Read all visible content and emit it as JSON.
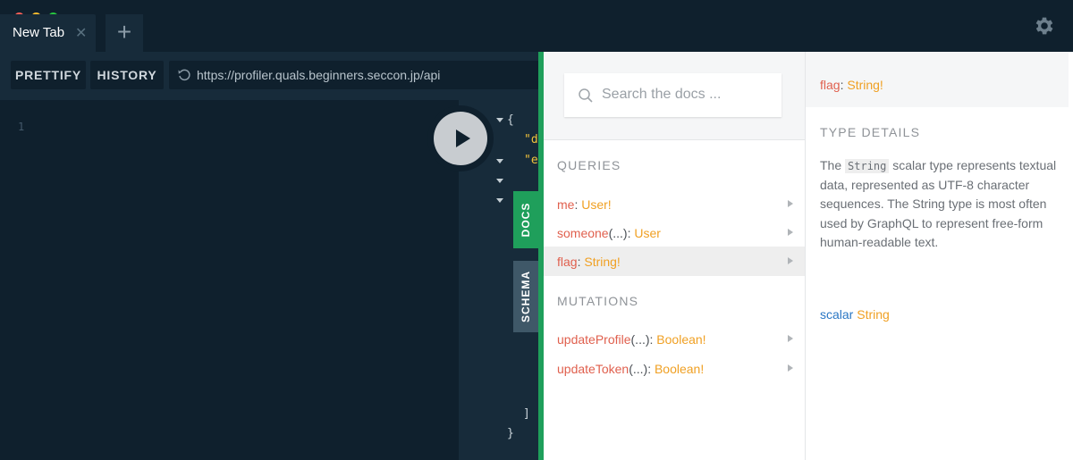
{
  "window": {
    "tab_label": "New Tab",
    "close_glyph": "✕",
    "new_tab_glyph": "+"
  },
  "toolbar": {
    "prettify_label": "PRETTIFY",
    "history_label": "HISTORY",
    "endpoint_url": "https://profiler.quals.beginners.seccon.jp/api"
  },
  "editor": {
    "line_numbers": [
      "1"
    ]
  },
  "result": {
    "lines": [
      "{",
      "\"d",
      "\"e",
      "]",
      "}"
    ]
  },
  "side_tabs": {
    "docs_label": "DOCS",
    "schema_label": "SCHEMA"
  },
  "docs": {
    "search_placeholder": "Search the docs ...",
    "queries_title": "QUERIES",
    "mutations_title": "MUTATIONS",
    "queries": [
      {
        "name": "me",
        "args": "",
        "type": "User!"
      },
      {
        "name": "someone",
        "args": "(...)",
        "type": "User"
      },
      {
        "name": "flag",
        "args": "",
        "type": "String!"
      }
    ],
    "mutations": [
      {
        "name": "updateProfile",
        "args": "(...)",
        "type": "Boolean!"
      },
      {
        "name": "updateToken",
        "args": "(...)",
        "type": "Boolean!"
      }
    ]
  },
  "detail": {
    "field_name": "flag",
    "field_type": "String!",
    "section_title": "TYPE DETAILS",
    "desc_pre": "The ",
    "desc_code": "String",
    "desc_post": " scalar type represents textual data, represented as UTF-8 character sequences. The String type is most often used by GraphQL to represent free-form human-readable text.",
    "scalar_keyword": "scalar",
    "scalar_name": "String"
  },
  "colors": {
    "accent_green": "#1f9f5b",
    "field_name": "#e0604e",
    "type_name": "#f0a023",
    "keyword": "#2a77c4"
  }
}
